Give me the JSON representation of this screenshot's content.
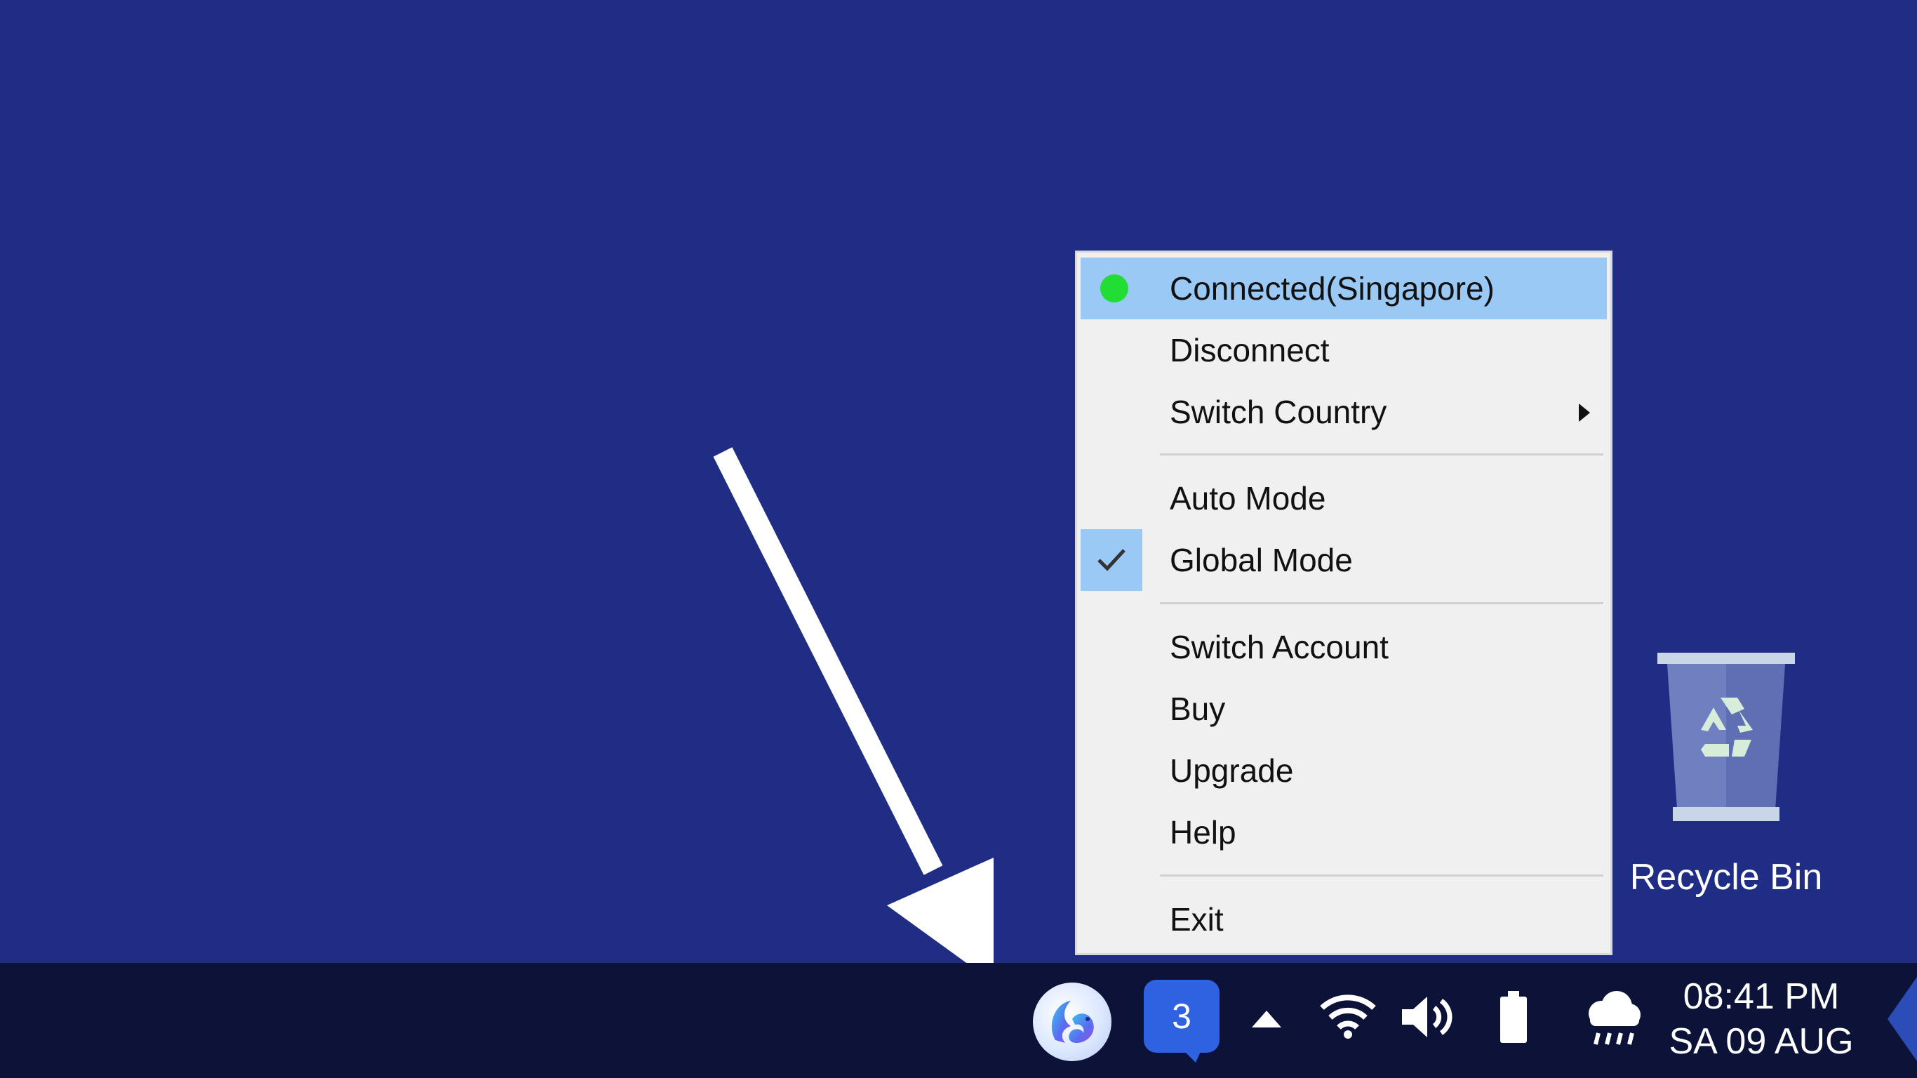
{
  "menu": {
    "status_label": "Connected(Singapore)",
    "status_color": "#22dd33",
    "items": {
      "disconnect": "Disconnect",
      "switch_country": "Switch Country",
      "auto_mode": "Auto Mode",
      "global_mode": "Global Mode",
      "switch_account": "Switch Account",
      "buy": "Buy",
      "upgrade": "Upgrade",
      "help": "Help",
      "exit": "Exit"
    },
    "checked_mode": "Global Mode"
  },
  "desktop": {
    "background_color": "#1f2d84",
    "recycle_bin_label": "Recycle Bin"
  },
  "taskbar": {
    "notification_count": "3",
    "clock_time": "08:41 PM",
    "clock_date": "SA 09 AUG",
    "tray_icons": [
      "vpn-app-icon",
      "notification-badge",
      "show-hidden-icons",
      "wifi-icon",
      "volume-icon",
      "battery-icon",
      "weather-rain-icon"
    ]
  }
}
